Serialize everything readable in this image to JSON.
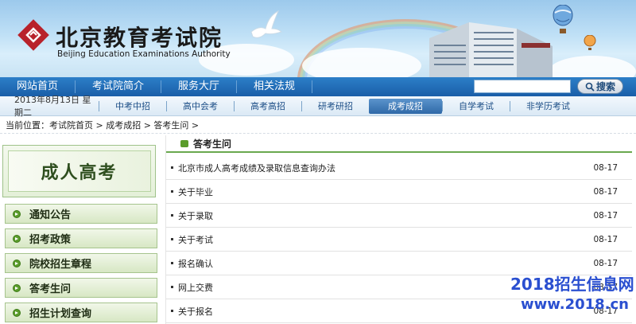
{
  "header": {
    "title_cn": "北京教育考试院",
    "title_en": "Beijing Education Examinations Authority"
  },
  "mainnav": {
    "items": [
      "网站首页",
      "考试院简介",
      "服务大厅",
      "相关法规"
    ],
    "search_placeholder": "",
    "search_label": "搜索"
  },
  "subnav": {
    "date": "2013年8月13日  星期二",
    "items": [
      "中考中招",
      "高中会考",
      "高考高招",
      "研考研招",
      "成考成招",
      "自学考试",
      "非学历考试"
    ],
    "active_index": 4
  },
  "breadcrumb": "当前位置：考试院首页 > 成考成招 > 答考生问 >",
  "sidebar": {
    "heading": "成人高考",
    "items": [
      "通知公告",
      "招考政策",
      "院校招生章程",
      "答考生问",
      "招生计划查询"
    ]
  },
  "content": {
    "heading": "答考生问",
    "rows": [
      {
        "title": "北京市成人高考成绩及录取信息查询办法",
        "date": "08-17"
      },
      {
        "title": "关于毕业",
        "date": "08-17"
      },
      {
        "title": "关于录取",
        "date": "08-17"
      },
      {
        "title": "关于考试",
        "date": "08-17"
      },
      {
        "title": "报名确认",
        "date": "08-17"
      },
      {
        "title": "网上交费",
        "date": "08-17"
      },
      {
        "title": "关于报名",
        "date": "08-17"
      }
    ]
  },
  "watermark": {
    "line1": "2018招生信息网",
    "line2": "www.2018.cn"
  },
  "colors": {
    "nav_blue": "#1a5ea8",
    "accent_green": "#6aa84f",
    "watermark_blue": "#2a4fd0"
  }
}
